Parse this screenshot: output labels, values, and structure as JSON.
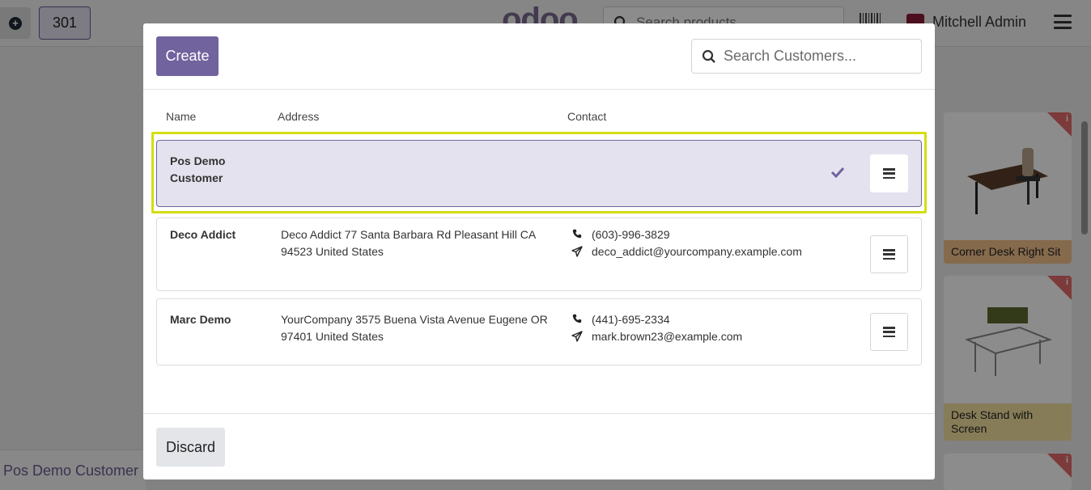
{
  "background": {
    "order_number": "301",
    "brand_logo": "odoo",
    "search_placeholder": "Search products...",
    "user_name": "Mitchell Admin",
    "products": [
      {
        "name": "Corner Desk Right Sit",
        "tag_color": "#f3c28a"
      },
      {
        "name": "Desk Stand with Screen",
        "tag_color": "#f6e2a0"
      }
    ],
    "partner_name": "Pos Demo Customer"
  },
  "modal": {
    "create_label": "Create",
    "search_placeholder": "Search Customers...",
    "columns": {
      "name": "Name",
      "address": "Address",
      "contact": "Contact"
    },
    "customers": [
      {
        "name": "Pos Demo Customer",
        "address": "",
        "phone": "",
        "email": "",
        "selected": true
      },
      {
        "name": "Deco Addict",
        "address": "Deco Addict 77 Santa Barbara Rd Pleasant Hill CA 94523 United States",
        "phone": "(603)-996-3829",
        "email": "deco_addict@yourcompany.example.com",
        "selected": false
      },
      {
        "name": "Marc Demo",
        "address": "YourCompany 3575 Buena Vista Avenue Eugene OR 97401 United States",
        "phone": "(441)-695-2334",
        "email": "mark.brown23@example.com",
        "selected": false
      }
    ],
    "discard_label": "Discard"
  },
  "colors": {
    "primary": "#71639e",
    "selected_row": "#e4e2ee",
    "highlight": "#d4dd12"
  }
}
